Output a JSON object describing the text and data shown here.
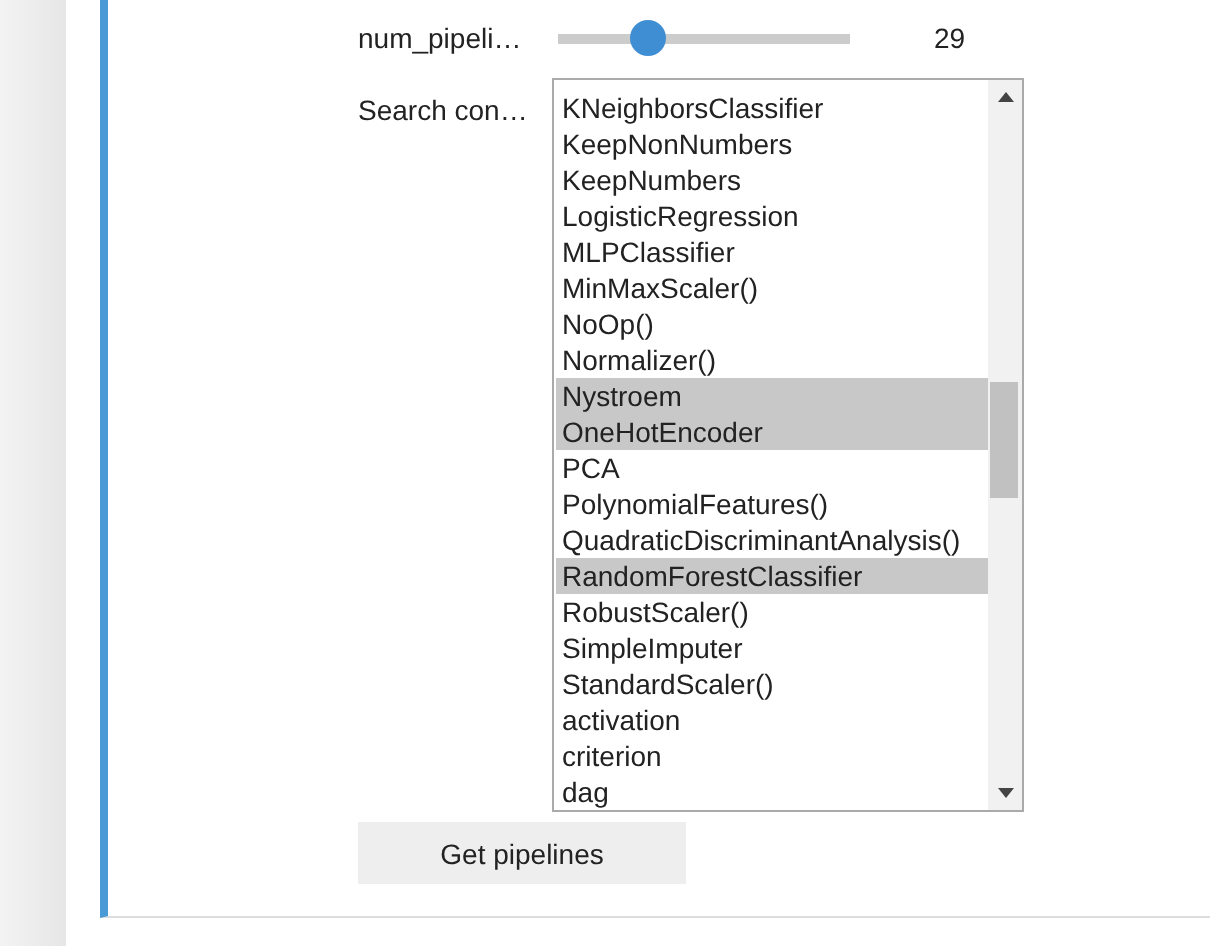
{
  "slider": {
    "label": "num_pipeli…",
    "level": 0.28,
    "reading": "29"
  },
  "search": {
    "label": "Search con…",
    "options": [
      {
        "label": "KNeighborsClassifier",
        "selected": false
      },
      {
        "label": "KeepNonNumbers",
        "selected": false
      },
      {
        "label": "KeepNumbers",
        "selected": false
      },
      {
        "label": "LogisticRegression",
        "selected": false
      },
      {
        "label": "MLPClassifier",
        "selected": false
      },
      {
        "label": "MinMaxScaler()",
        "selected": false
      },
      {
        "label": "NoOp()",
        "selected": false
      },
      {
        "label": "Normalizer()",
        "selected": false
      },
      {
        "label": "Nystroem",
        "selected": true
      },
      {
        "label": "OneHotEncoder",
        "selected": true
      },
      {
        "label": "PCA",
        "selected": false
      },
      {
        "label": "PolynomialFeatures()",
        "selected": false
      },
      {
        "label": "QuadraticDiscriminantAnalysis()",
        "selected": false
      },
      {
        "label": "RandomForestClassifier",
        "selected": true
      },
      {
        "label": "RobustScaler()",
        "selected": false
      },
      {
        "label": "SimpleImputer",
        "selected": false
      },
      {
        "label": "StandardScaler()",
        "selected": false
      },
      {
        "label": "activation",
        "selected": false
      },
      {
        "label": "criterion",
        "selected": false
      },
      {
        "label": "dag",
        "selected": false
      }
    ]
  },
  "button": {
    "label": "Get pipelines"
  }
}
